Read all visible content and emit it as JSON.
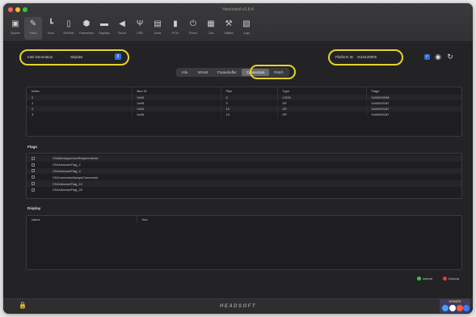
{
  "window": {
    "title": "Hackintool v3.8.4"
  },
  "colors": {
    "accent": "#2f6fe0",
    "highlight": "#e4d32a",
    "internal": "#3cc24a",
    "external": "#e53b3b"
  },
  "toolbar": [
    {
      "label": "System",
      "icon": "computer-icon"
    },
    {
      "label": "Patch",
      "icon": "wrench-patch-icon",
      "active": true
    },
    {
      "label": "Boot",
      "icon": "boot-icon"
    },
    {
      "label": "NVRAM",
      "icon": "nvram-icon"
    },
    {
      "label": "Extensions",
      "icon": "extensions-icon"
    },
    {
      "label": "Displays",
      "icon": "display-icon"
    },
    {
      "label": "Sound",
      "icon": "speaker-icon"
    },
    {
      "label": "USB",
      "icon": "usb-icon"
    },
    {
      "label": "Disks",
      "icon": "disk-icon"
    },
    {
      "label": "PCIe",
      "icon": "pcie-icon"
    },
    {
      "label": "Power",
      "icon": "power-icon"
    },
    {
      "label": "Calc",
      "icon": "calculator-icon"
    },
    {
      "label": "Utilities",
      "icon": "utilities-icon"
    },
    {
      "label": "Logs",
      "icon": "logs-icon"
    }
  ],
  "intel_generation": {
    "label": "Intel Generation",
    "value": "Skylake"
  },
  "platform_id": {
    "label": "Platform ID",
    "value": "0x19120000"
  },
  "tabs": [
    "Info",
    "VRAM",
    "Framebuffer",
    "Connectors",
    "Patch"
  ],
  "active_tab": "Connectors",
  "connectors": {
    "columns": [
      "Index",
      "Bus ID",
      "Pipe",
      "Type",
      "Flags"
    ],
    "rows": [
      [
        "0",
        "0x00",
        "8",
        "LVDS",
        "0x00000098"
      ],
      [
        "1",
        "0x05",
        "9",
        "DP",
        "0x00000187"
      ],
      [
        "2",
        "0x04",
        "10",
        "DP",
        "0x00000187"
      ],
      [
        "3",
        "0x06",
        "10",
        "DP",
        "0x00000187"
      ]
    ]
  },
  "flags": {
    "title": "Flags",
    "items": [
      "CNAlterAppertureRequirements",
      "CNUnknownFlag_2",
      "CNUnknownFlag_4",
      "CNConnectorAlwaysConnected",
      "CNUnknownFlag_10",
      "CNUnknownFlag_20"
    ]
  },
  "display": {
    "title": "Display",
    "columns": [
      "Name",
      "Hex"
    ]
  },
  "legend": {
    "internal": "Internal",
    "external": "External"
  },
  "footer": {
    "brand": "HEADSOFT",
    "donate": "DONATE"
  }
}
